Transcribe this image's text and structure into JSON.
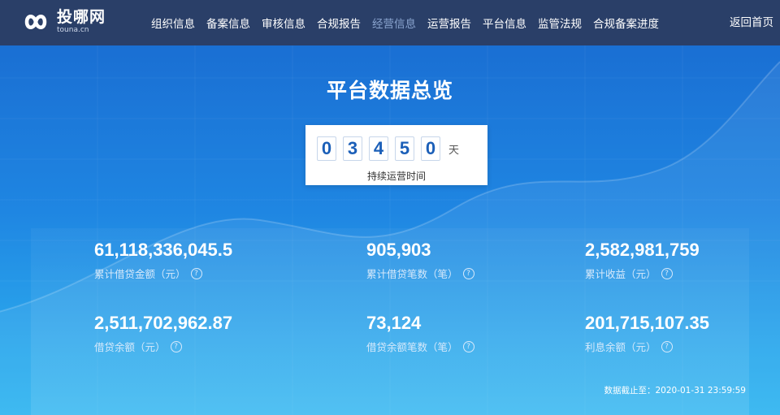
{
  "logo": {
    "name": "投哪网",
    "domain": "touna.cn",
    "icon": "infinity-logo-icon"
  },
  "nav": {
    "items": [
      {
        "label": "组织信息",
        "active": false
      },
      {
        "label": "备案信息",
        "active": false
      },
      {
        "label": "审核信息",
        "active": false
      },
      {
        "label": "合规报告",
        "active": false
      },
      {
        "label": "经营信息",
        "active": true
      },
      {
        "label": "运营报告",
        "active": false
      },
      {
        "label": "平台信息",
        "active": false
      },
      {
        "label": "监管法规",
        "active": false
      },
      {
        "label": "合规备案进度",
        "active": false
      }
    ],
    "home_label": "返回首页"
  },
  "overview": {
    "title": "平台数据总览",
    "counter": {
      "digits": [
        "0",
        "3",
        "4",
        "5",
        "0"
      ],
      "unit": "天",
      "label": "持续运营时间"
    },
    "stats": [
      {
        "value": "61,118,336,045.5",
        "label": "累计借贷金额（元）"
      },
      {
        "value": "905,903",
        "label": "累计借贷笔数（笔）"
      },
      {
        "value": "2,582,981,759",
        "label": "累计收益（元）"
      },
      {
        "value": "2,511,702,962.87",
        "label": "借贷余额（元）"
      },
      {
        "value": "73,124",
        "label": "借贷余额笔数（笔）"
      },
      {
        "value": "201,715,107.35",
        "label": "利息余额（元）"
      }
    ],
    "help_glyph": "?",
    "cutoff": "数据截止至：2020-01-31 23:59:59"
  },
  "colors": {
    "topbar": "#2a3f68",
    "hero_top": "#1a6fd3",
    "hero_bottom": "#30b5f0",
    "nav_active": "#8aa4cf",
    "digit_text": "#1b5fb8"
  }
}
